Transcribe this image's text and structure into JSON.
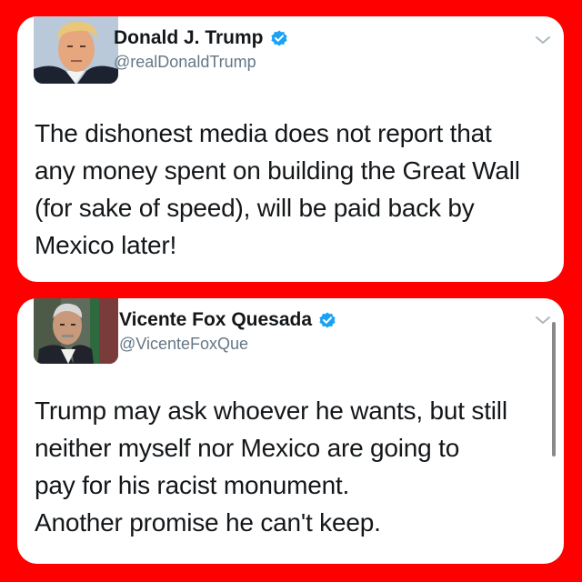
{
  "tweets": [
    {
      "author": {
        "display_name": "Donald J. Trump",
        "handle": "@realDonaldTrump",
        "verified": true,
        "avatar_icon": "profile-photo-icon"
      },
      "text": "The dishonest media does not report that\nany money spent on building the Great Wall\n(for sake of speed), will be paid back by\nMexico later!"
    },
    {
      "author": {
        "display_name": "Vicente Fox Quesada",
        "handle": "@VicenteFoxQue",
        "verified": true,
        "avatar_icon": "profile-photo-icon"
      },
      "text": "Trump may ask whoever he wants, but still\nneither myself nor Mexico are going to\npay for his racist monument.\nAnother promise he can't keep."
    }
  ],
  "colors": {
    "frame_background": "#ff0000",
    "card_background": "#ffffff",
    "verified_badge": "#1da1f2",
    "text_primary": "#14171a",
    "text_secondary": "#657786"
  }
}
